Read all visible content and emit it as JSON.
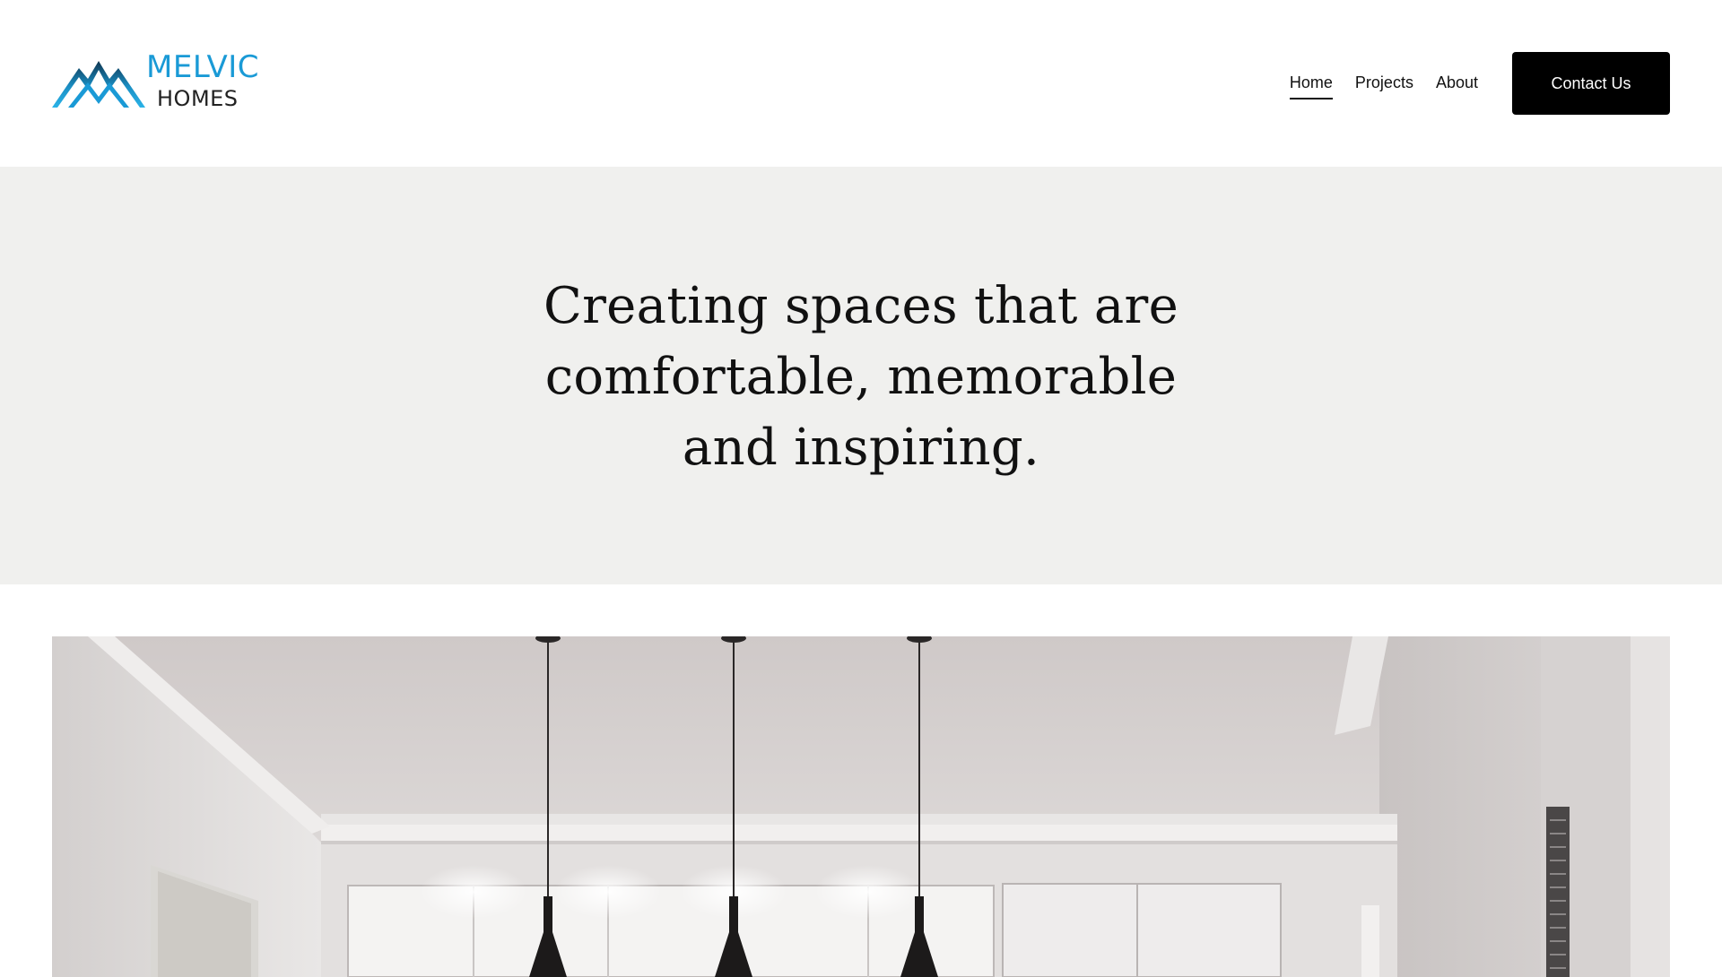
{
  "brand": {
    "name_line1": "MELVIC",
    "name_line2": "HOMES",
    "accent_color": "#1a9ad6"
  },
  "nav": {
    "items": [
      {
        "label": "Home",
        "active": true
      },
      {
        "label": "Projects",
        "active": false
      },
      {
        "label": "About",
        "active": false
      }
    ],
    "cta_label": "Contact Us"
  },
  "hero": {
    "title": "Creating spaces that are comfortable, memorable and inspiring.",
    "background": "#f0f0ee"
  },
  "feature_image": {
    "subject": "interior-with-pendant-lights"
  }
}
